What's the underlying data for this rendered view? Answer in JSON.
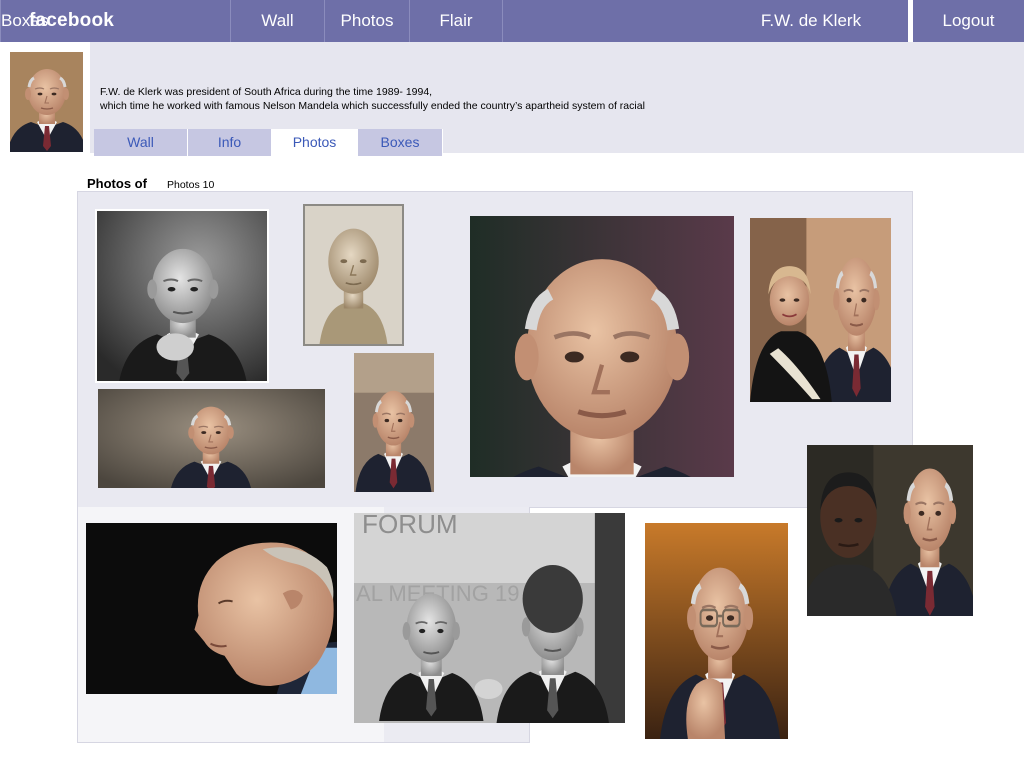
{
  "topbar": {
    "brand": "facebook",
    "nav": [
      "Wall",
      "Photos",
      "Flair",
      "Boxes"
    ],
    "user_name": "F.W. de Klerk",
    "logout_label": "Logout"
  },
  "profile": {
    "bio_line1": "F.W. de Klerk was president of South Africa during the time 1989- 1994,",
    "bio_line2": "which time he worked with famous Nelson Mandela which successfully ended the country’s apartheid system of racial",
    "tabs": [
      "Wall",
      "Info",
      "Photos",
      "Boxes"
    ],
    "active_tab": "Photos"
  },
  "photos": {
    "title": "Photos of",
    "count_label": "Photos 10",
    "items": [
      {
        "name": "photo-bw-portrait-hand-on-chin"
      },
      {
        "name": "photo-bronze-bust"
      },
      {
        "name": "photo-closeup-looking-up"
      },
      {
        "name": "photo-with-woman"
      },
      {
        "name": "photo-smiling-portrait-wide"
      },
      {
        "name": "photo-smiling-small"
      },
      {
        "name": "photo-two-actors"
      },
      {
        "name": "photo-profile-dark-background"
      },
      {
        "name": "photo-handshake-with-mandela"
      },
      {
        "name": "photo-with-glasses-pointing"
      }
    ]
  },
  "colors": {
    "topbar": "#6e6fa8",
    "profile_band": "#e6e6ef",
    "tab_inactive": "#c6c7e2",
    "tab_text": "#3b59b8",
    "photo_panel": "#e9e9f1"
  }
}
